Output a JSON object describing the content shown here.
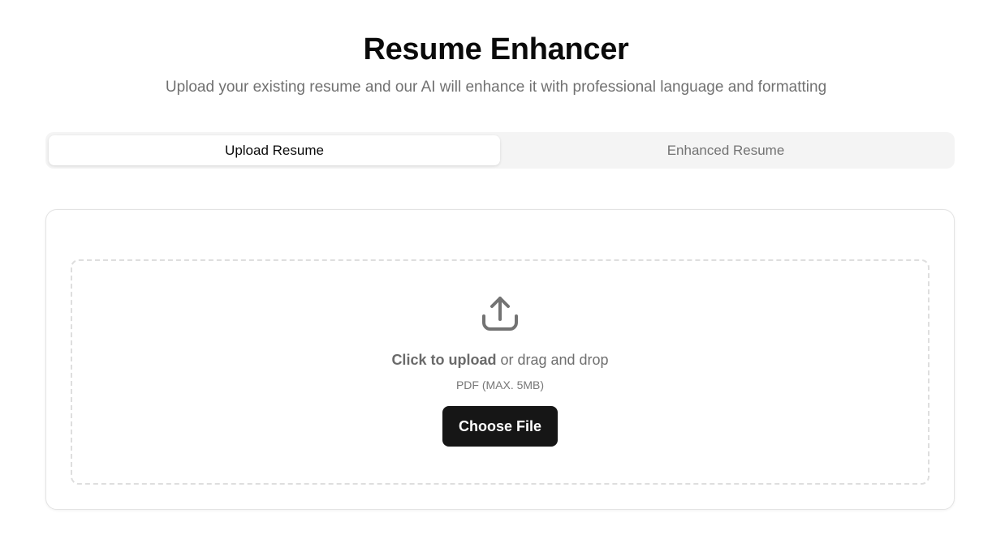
{
  "header": {
    "title": "Resume Enhancer",
    "subtitle": "Upload your existing resume and our AI will enhance it with professional language and formatting"
  },
  "tabs": [
    {
      "label": "Upload Resume",
      "active": true
    },
    {
      "label": "Enhanced Resume",
      "active": false
    }
  ],
  "upload": {
    "icon": "upload-icon",
    "click_label": "Click to upload",
    "drag_label": "or drag and drop",
    "hint": "PDF (MAX. 5MB)",
    "button_label": "Choose File"
  },
  "colors": {
    "button_bg": "#161616",
    "tab_track": "#f4f4f4",
    "icon": "#737373"
  }
}
